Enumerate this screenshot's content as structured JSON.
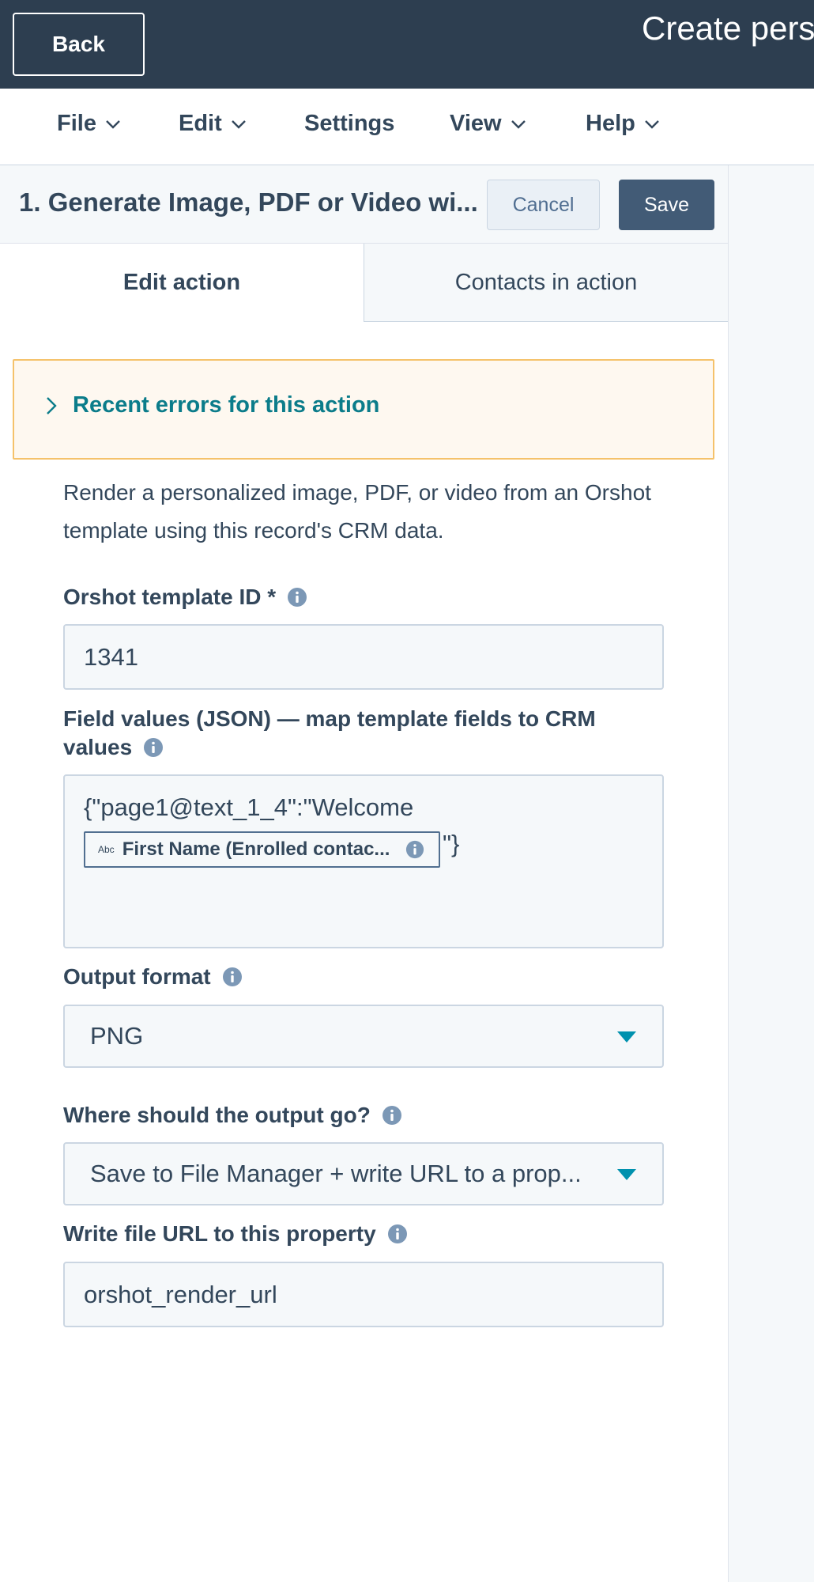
{
  "topbar": {
    "back_label": "Back",
    "title": "Create perso"
  },
  "menu": {
    "items": [
      {
        "label": "File",
        "has_dropdown": true
      },
      {
        "label": "Edit",
        "has_dropdown": true
      },
      {
        "label": "Settings",
        "has_dropdown": false
      },
      {
        "label": "View",
        "has_dropdown": true
      },
      {
        "label": "Help",
        "has_dropdown": true
      }
    ]
  },
  "panel": {
    "title": "1. Generate Image, PDF or Video wi...",
    "cancel_label": "Cancel",
    "save_label": "Save",
    "tabs": [
      {
        "label": "Edit action",
        "active": true
      },
      {
        "label": "Contacts in action",
        "active": false
      }
    ]
  },
  "alert": {
    "text": "Recent errors for this action"
  },
  "description": "Render a personalized image, PDF, or video from an Orshot template using this record's CRM data.",
  "fields": {
    "template_id": {
      "label": "Orshot template ID *",
      "value": "1341"
    },
    "field_values": {
      "label": "Field values (JSON) — map template fields to CRM values",
      "line1": "{\"page1@text_1_4\":\"Welcome",
      "token_prefix": "Abc",
      "token_label": "First Name (Enrolled contac...",
      "tail": "\"}"
    },
    "output_format": {
      "label": "Output format",
      "value": "PNG"
    },
    "destination": {
      "label": "Where should the output go?",
      "value": "Save to File Manager + write URL to a prop..."
    },
    "url_property": {
      "label": "Write file URL to this property",
      "value": "orshot_render_url"
    }
  },
  "colors": {
    "header_bg": "#2d3e50",
    "accent_teal": "#0b7c8a",
    "save_bg": "#425b76",
    "alert_border": "#f5c26b",
    "alert_bg": "#fef8f0",
    "caret": "#0091ae"
  },
  "icons": {
    "menu_dropdown": "chevron-down-icon",
    "alert_expand": "chevron-right-icon",
    "field_help": "info-icon",
    "select_open": "caret-down-icon"
  }
}
